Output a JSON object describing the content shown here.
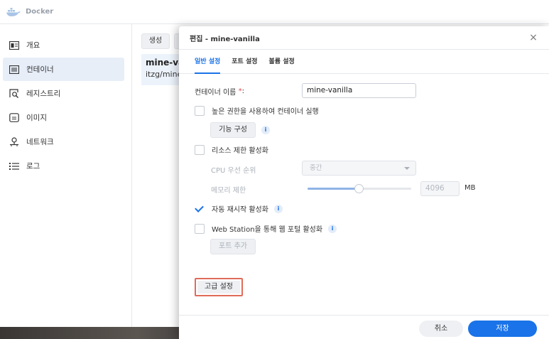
{
  "app": {
    "title": "Docker"
  },
  "sidebar": {
    "items": [
      {
        "label": "개요",
        "icon": "overview-icon"
      },
      {
        "label": "컨테이너",
        "icon": "container-list-icon",
        "active": true
      },
      {
        "label": "레지스트리",
        "icon": "registry-search-icon"
      },
      {
        "label": "이미지",
        "icon": "image-icon"
      },
      {
        "label": "네트워크",
        "icon": "network-icon"
      },
      {
        "label": "로그",
        "icon": "log-list-icon"
      }
    ]
  },
  "main": {
    "create_label": "생성",
    "container": {
      "name": "mine-vanilla",
      "image": "itzg/minecraft-server"
    }
  },
  "dialog": {
    "title": "편집 - mine-vanilla",
    "close_symbol": "×",
    "tabs": [
      "일반 설정",
      "포트 설정",
      "볼륨 설정"
    ],
    "active_tab": 0,
    "container_name_label": "컨테이너 이름",
    "required_mark": "*",
    "colon": ":",
    "container_name_value": "mine-vanilla",
    "privileged_label": "높은 권한을 사용하여 컨테이너 실행",
    "privileged_checked": false,
    "capabilities_button": "기능 구성",
    "resource_limit_label": "리소스 제한 활성화",
    "resource_limit_checked": false,
    "cpu_priority_label": "CPU 우선 순위",
    "cpu_priority_value": "중간",
    "memory_limit_label": "메모리 제한",
    "memory_limit_value": "4096",
    "memory_unit": "MB",
    "memory_slider_fraction": 0.5,
    "auto_restart_label": "자동 재시작 활성화",
    "auto_restart_checked": true,
    "web_station_label": "Web Station을 통해 웹 포털 활성화",
    "web_station_checked": false,
    "add_port_button": "포트 추가",
    "advanced_button": "고급 설정",
    "cancel_button": "취소",
    "save_button": "저장",
    "info_symbol": "i"
  },
  "colors": {
    "accent": "#1a73e8",
    "highlight_border": "#e06b5a",
    "required": "#e5484d"
  }
}
